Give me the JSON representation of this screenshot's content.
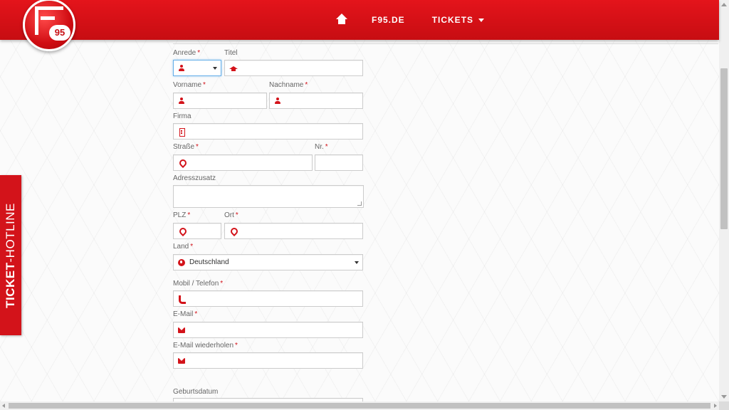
{
  "header": {
    "logo_number": "95",
    "nav": {
      "home_icon": "home-icon",
      "link1": "F95.DE",
      "link2": "TICKETS"
    }
  },
  "hotline": {
    "bold": "TICKET",
    "rest": "-HOTLINE"
  },
  "form": {
    "anrede": {
      "label": "Anrede",
      "required": "*",
      "value": "",
      "icon": "person-icon"
    },
    "titel": {
      "label": "Titel",
      "value": "",
      "icon": "graduation-cap-icon"
    },
    "vorname": {
      "label": "Vorname",
      "required": "*",
      "value": "",
      "icon": "person-icon"
    },
    "nachname": {
      "label": "Nachname",
      "required": "*",
      "value": "",
      "icon": "person-icon"
    },
    "firma": {
      "label": "Firma",
      "value": "",
      "icon": "building-icon"
    },
    "strasse": {
      "label": "Straße",
      "required": "*",
      "value": "",
      "icon": "map-pin-icon"
    },
    "nr": {
      "label": "Nr.",
      "required": "*",
      "value": ""
    },
    "adresszusatz": {
      "label": "Adresszusatz",
      "value": ""
    },
    "plz": {
      "label": "PLZ",
      "required": "*",
      "value": "",
      "icon": "map-pin-icon"
    },
    "ort": {
      "label": "Ort",
      "required": "*",
      "value": "",
      "icon": "map-pin-icon"
    },
    "land": {
      "label": "Land",
      "required": "*",
      "value": "Deutschland",
      "icon": "globe-icon"
    },
    "mobil": {
      "label": "Mobil / Telefon",
      "required": "*",
      "value": "",
      "icon": "phone-icon"
    },
    "email": {
      "label": "E-Mail",
      "required": "*",
      "value": "",
      "icon": "envelope-icon"
    },
    "email_repeat": {
      "label": "E-Mail wiederholen",
      "required": "*",
      "value": "",
      "icon": "envelope-icon"
    },
    "geburtsdatum": {
      "label": "Geburtsdatum"
    }
  },
  "colors": {
    "brand_red": "#d3131a",
    "focus_blue": "#66afe9"
  }
}
